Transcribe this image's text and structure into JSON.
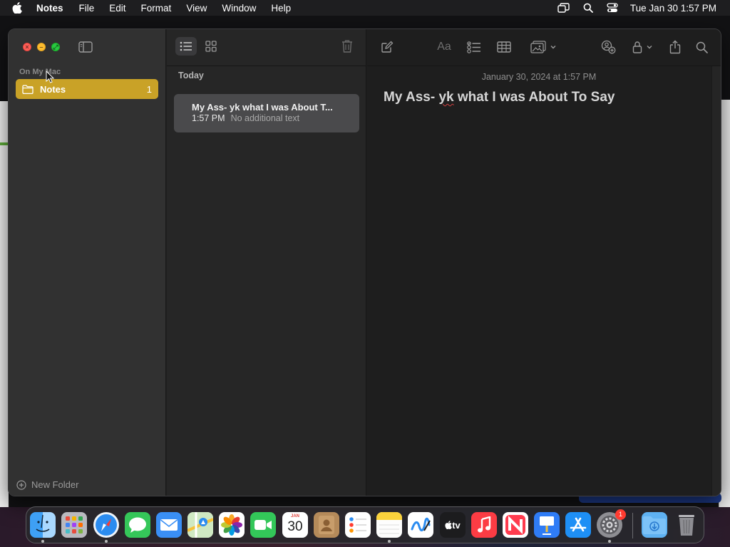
{
  "menubar": {
    "app_name": "Notes",
    "menus": [
      "File",
      "Edit",
      "Format",
      "View",
      "Window",
      "Help"
    ],
    "clock": "Tue Jan 30  1:57 PM",
    "status_icons": [
      "screen-mirroring-icon",
      "spotlight-search-icon",
      "control-center-icon"
    ]
  },
  "sidebar": {
    "section_label": "On My Mac",
    "folders": [
      {
        "name": "Notes",
        "count": "1",
        "selected": true
      }
    ],
    "new_folder_label": "New Folder"
  },
  "note_list": {
    "group_label": "Today",
    "notes": [
      {
        "title": "My Ass- yk what I was About T...",
        "time": "1:57 PM",
        "preview": "No additional text"
      }
    ]
  },
  "editor": {
    "date": "January 30, 2024 at 1:57 PM",
    "heading_before": "My Ass- ",
    "heading_misspelled": "yk",
    "heading_after": " what I was About To Say",
    "format_label": "Aa"
  },
  "dock": {
    "calendar_month": "JAN",
    "calendar_day": "30",
    "tv_label": "tv",
    "settings_badge": "1",
    "apps": [
      "Finder",
      "Launchpad",
      "Safari",
      "Messages",
      "Mail",
      "Maps",
      "Photos",
      "FaceTime",
      "Calendar",
      "Contacts",
      "Reminders",
      "Notes",
      "Freeform",
      "TV",
      "Music",
      "News",
      "Keynote",
      "App Store",
      "System Settings",
      "Downloads",
      "Trash"
    ]
  },
  "colors": {
    "accent_folder": "#c9a227",
    "traffic_close": "#ff5f57",
    "traffic_min": "#febc2e",
    "traffic_zoom": "#28c840"
  }
}
